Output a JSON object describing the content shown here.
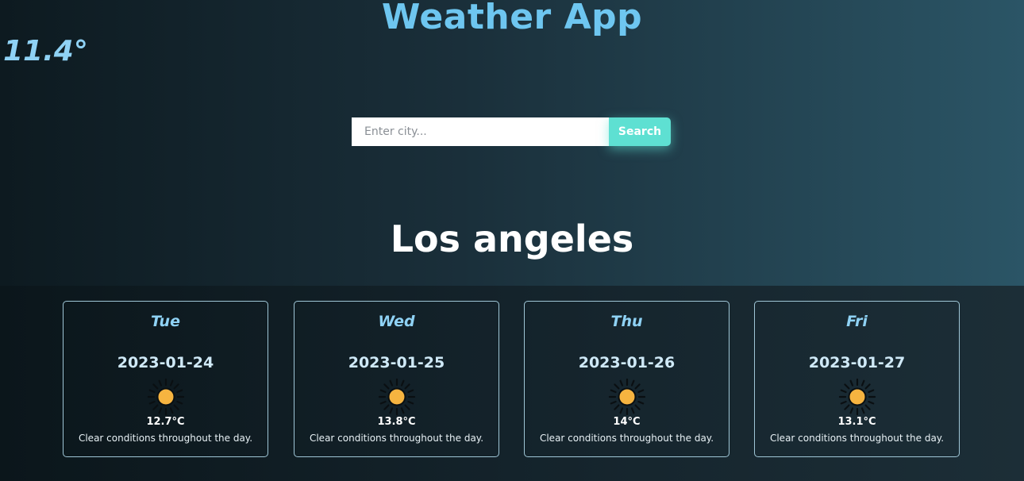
{
  "header": {
    "title": "Weather App",
    "current_temp": "11.4°"
  },
  "search": {
    "placeholder": "Enter city...",
    "value": "",
    "button_label": "Search"
  },
  "city": {
    "name": "Los angeles"
  },
  "forecast": [
    {
      "day": "Tue",
      "date": "2023-01-24",
      "icon": "sun-icon",
      "temp": "12.7°C",
      "desc": "Clear conditions throughout the day."
    },
    {
      "day": "Wed",
      "date": "2023-01-25",
      "icon": "sun-icon",
      "temp": "13.8°C",
      "desc": "Clear conditions throughout the day."
    },
    {
      "day": "Thu",
      "date": "2023-01-26",
      "icon": "sun-icon",
      "temp": "14°C",
      "desc": "Clear conditions throughout the day."
    },
    {
      "day": "Fri",
      "date": "2023-01-27",
      "icon": "sun-icon",
      "temp": "13.1°C",
      "desc": "Clear conditions throughout the day."
    }
  ],
  "colors": {
    "accent": "#6ec6f0",
    "button": "#5ee0d2",
    "sun": "#f6b440"
  }
}
